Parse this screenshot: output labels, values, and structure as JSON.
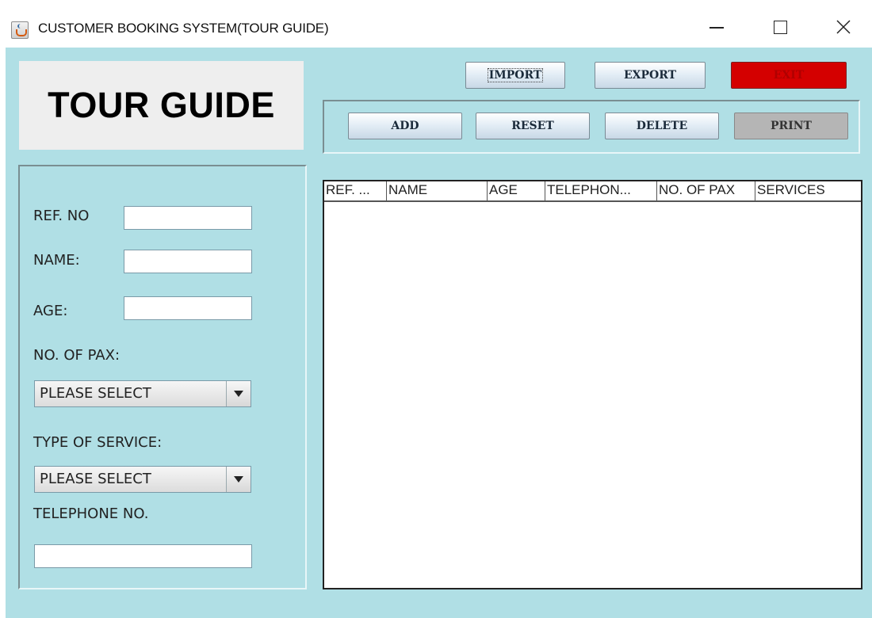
{
  "window": {
    "title": "CUSTOMER BOOKING SYSTEM(TOUR GUIDE)",
    "controls": [
      "minimize",
      "maximize",
      "close"
    ]
  },
  "logo": {
    "text": "TOUR GUIDE"
  },
  "form": {
    "ref_no_label": "REF. NO",
    "ref_no_value": "",
    "name_label": "NAME:",
    "name_value": "",
    "age_label": "AGE:",
    "age_value": "",
    "pax_label": "NO. OF PAX:",
    "pax_selected": "PLEASE SELECT",
    "service_label": "TYPE OF SERVICE:",
    "service_selected": "PLEASE SELECT",
    "telephone_label": "TELEPHONE NO.",
    "telephone_value": ""
  },
  "toolbar": {
    "import_label": "IMPORT",
    "export_label": "EXPORT",
    "exit_label": "EXIT",
    "add_label": "ADD",
    "reset_label": "RESET",
    "delete_label": "DELETE",
    "print_label": "PRINT"
  },
  "table": {
    "columns": [
      "REF. ...",
      "NAME",
      "AGE",
      "TELEPHON...",
      "NO. OF PAX",
      "SERVICES"
    ],
    "rows": []
  },
  "colors": {
    "background": "#b0dfe5",
    "exit_button": "#d40000",
    "print_button": "#b5b5b5"
  }
}
